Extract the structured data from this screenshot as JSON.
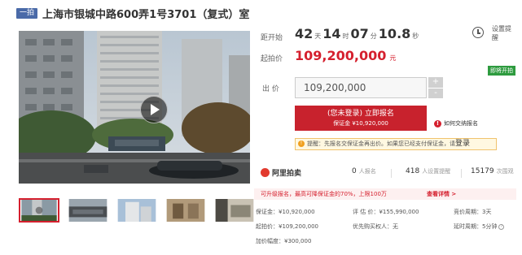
{
  "title": {
    "badge": "一拍",
    "text": "上海市银城中路600弄1号3701（复式）室"
  },
  "countdown": {
    "label": "距开始",
    "days": "42",
    "days_unit": "天",
    "hours": "14",
    "hours_unit": "时",
    "minutes": "07",
    "minutes_unit": "分",
    "seconds": "10.8",
    "seconds_unit": "秒"
  },
  "start_price": {
    "label": "起拍价",
    "value": "109,200,000",
    "unit": "元"
  },
  "reminder": {
    "label": "设置提醒"
  },
  "tag": {
    "label": "即将开拍"
  },
  "bid": {
    "label": "出 价",
    "value": "109,200,000",
    "plus": "+",
    "minus": "-"
  },
  "register": {
    "line1": "(您未登录) 立即报名",
    "line2": "保证金 ¥10,920,000"
  },
  "how_pay": {
    "icon": "!",
    "label": "如何交纳报名"
  },
  "tip": {
    "icon": "!",
    "prefix": "提醒：先报名交保证金再出价。如果您已经支付保证金，请",
    "login": "登录"
  },
  "brand": {
    "name": "阿里拍卖"
  },
  "stats": [
    {
      "num": "0",
      "text": "人报名"
    },
    {
      "num": "418",
      "text": "人设置提醒"
    },
    {
      "num": "15179",
      "text": "次围观"
    }
  ],
  "notice": {
    "text": "可升级报名，最高可降保证金的70%，上限100万",
    "more": "查看详情 >"
  },
  "info": {
    "deposit": "保证金：¥10,920,000",
    "appraisal": "评 估 价：¥155,990,000",
    "period": "竞价周期：3天",
    "start": "起拍价：¥109,200,000",
    "priority": "优先购买权人",
    "priority_value": "：无",
    "delay": "延时周期：5分钟",
    "delay_icon": "?",
    "increment": "加价幅度：¥300,000"
  },
  "accent_color": "#d5202e"
}
